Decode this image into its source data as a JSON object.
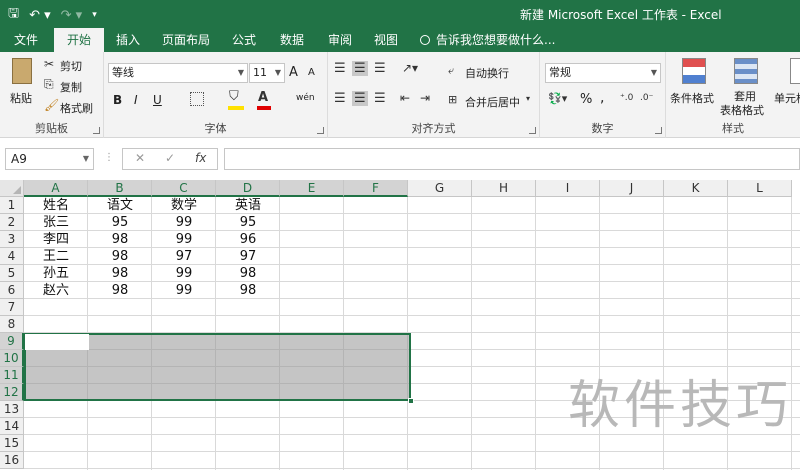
{
  "window": {
    "title": "新建 Microsoft Excel 工作表 - Excel"
  },
  "qat": {
    "save_icon": "save-icon",
    "undo_icon": "undo-icon",
    "redo_icon": "redo-icon"
  },
  "tabs": [
    {
      "label": "文件"
    },
    {
      "label": "开始"
    },
    {
      "label": "插入"
    },
    {
      "label": "页面布局"
    },
    {
      "label": "公式"
    },
    {
      "label": "数据"
    },
    {
      "label": "审阅"
    },
    {
      "label": "视图"
    }
  ],
  "tell_me": "告诉我您想要做什么...",
  "ribbon": {
    "clipboard": {
      "paste": "粘贴",
      "cut": "剪切",
      "copy": "复制",
      "painter": "格式刷",
      "label": "剪贴板"
    },
    "font": {
      "name": "等线",
      "size": "11",
      "label": "字体",
      "bold": "B",
      "italic": "I",
      "underline": "U",
      "grow": "A",
      "shrink": "A",
      "wen": "wén"
    },
    "alignment": {
      "wrap": "自动换行",
      "merge": "合并后居中",
      "label": "对齐方式"
    },
    "number": {
      "format": "常规",
      "label": "数字",
      "percent": "%",
      "comma": ","
    },
    "styles": {
      "cond": "条件格式",
      "table_line1": "套用",
      "table_line2": "表格格式",
      "cell": "单元格",
      "label": "样式"
    }
  },
  "formula_bar": {
    "name_box": "A9",
    "cancel": "✕",
    "enter": "✓",
    "fx": "fx",
    "formula": ""
  },
  "grid": {
    "columns": [
      "A",
      "B",
      "C",
      "D",
      "E",
      "F",
      "G",
      "H",
      "I",
      "J",
      "K",
      "L"
    ],
    "rows": [
      "1",
      "2",
      "3",
      "4",
      "5",
      "6",
      "7",
      "8",
      "9",
      "10",
      "11",
      "12",
      "13",
      "14",
      "15",
      "16"
    ],
    "cells": [
      [
        "姓名",
        "语文",
        "数学",
        "英语"
      ],
      [
        "张三",
        "95",
        "99",
        "95"
      ],
      [
        "李四",
        "98",
        "99",
        "96"
      ],
      [
        "王二",
        "98",
        "97",
        "97"
      ],
      [
        "孙五",
        "98",
        "99",
        "98"
      ],
      [
        "赵六",
        "98",
        "99",
        "98"
      ]
    ]
  },
  "watermark": "软件技巧"
}
